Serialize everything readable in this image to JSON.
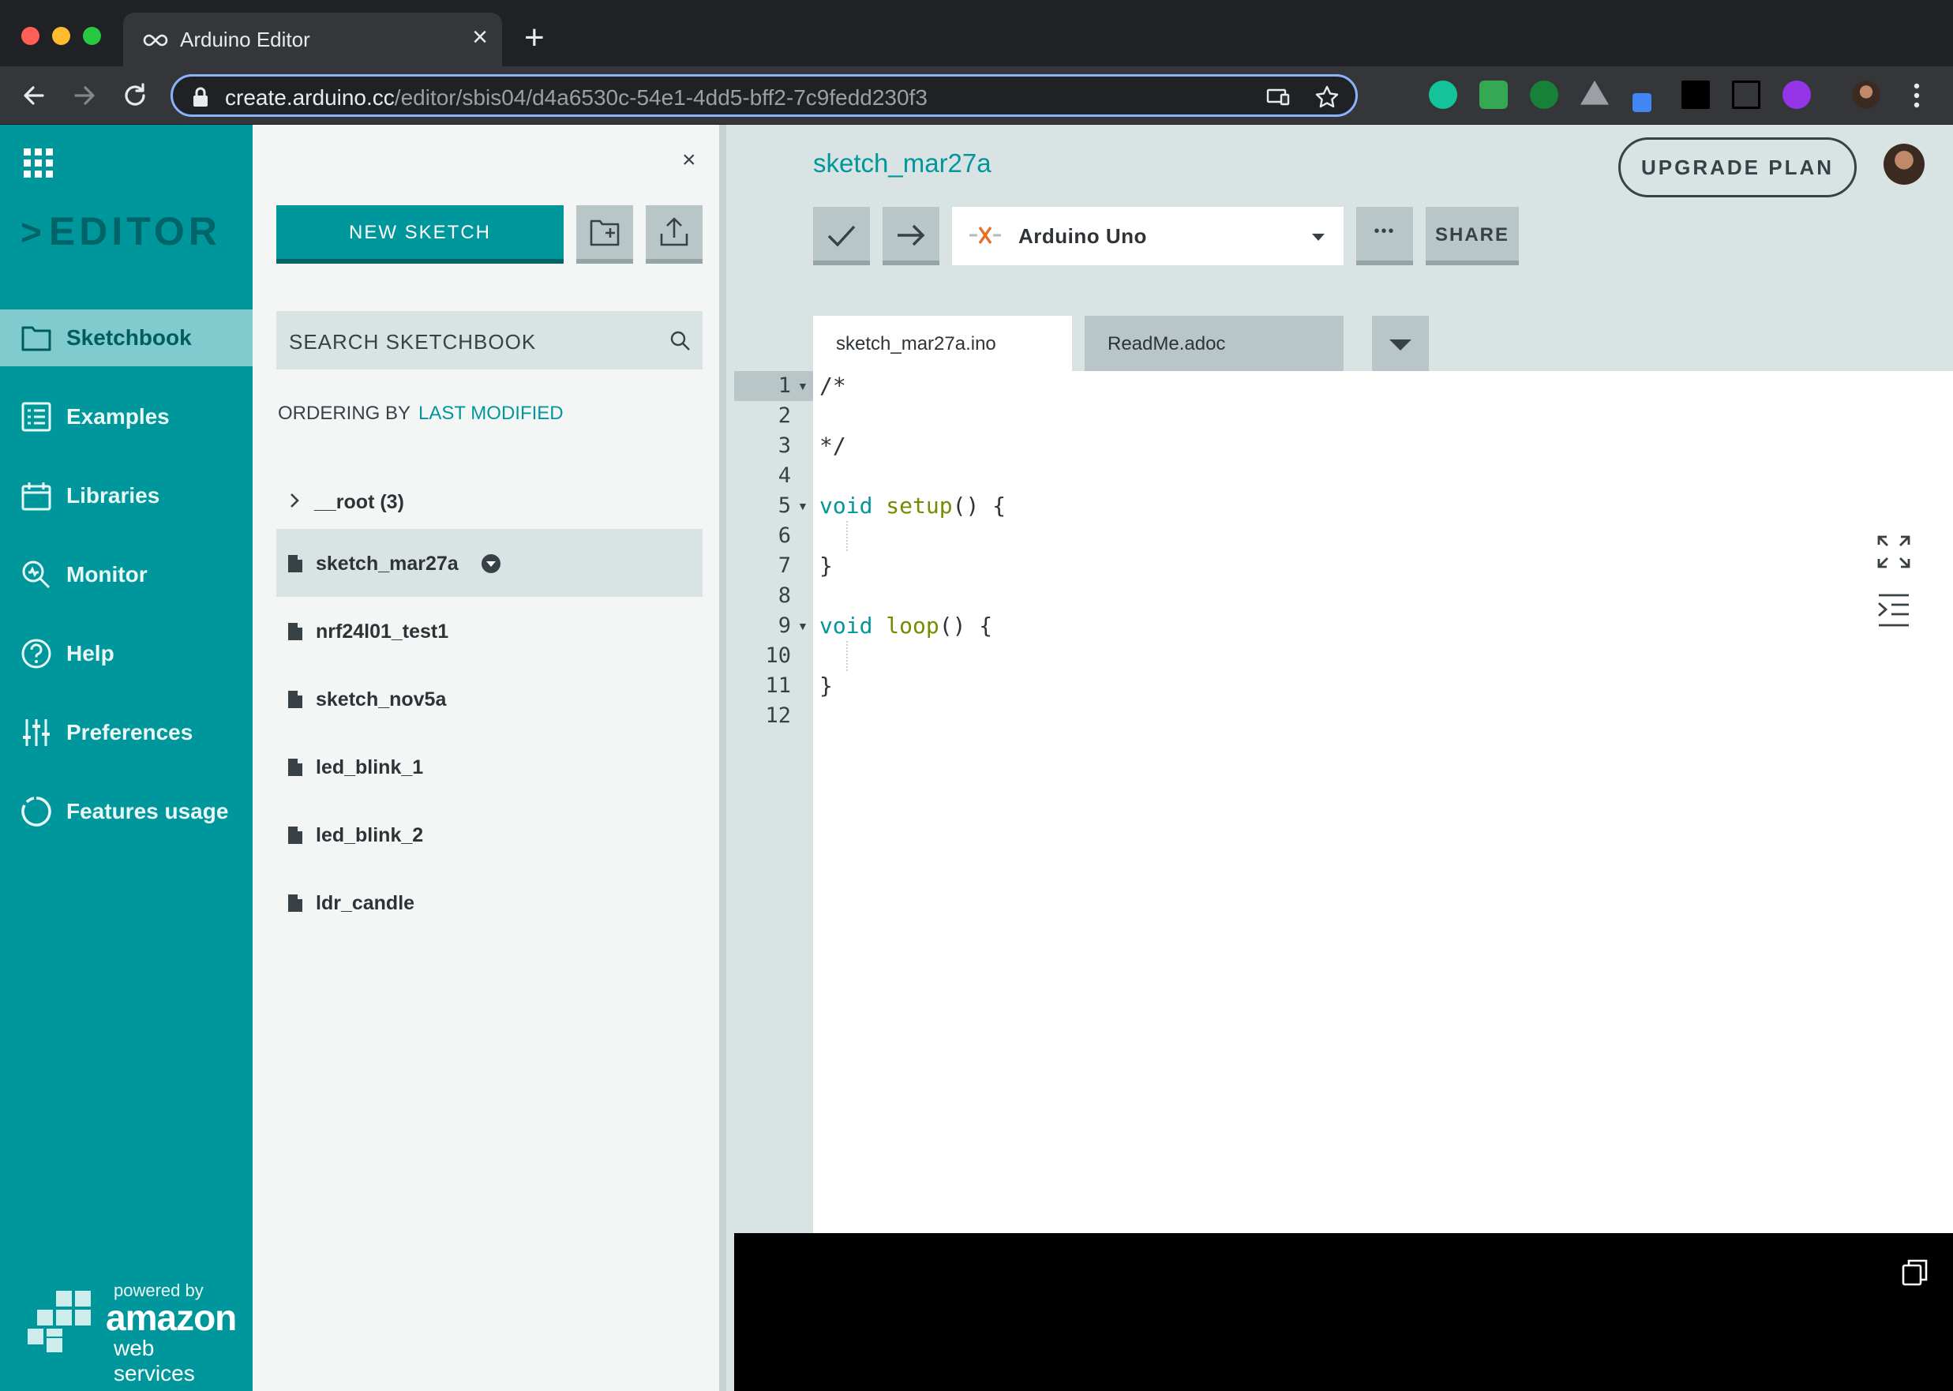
{
  "browser": {
    "tab_title": "Arduino Editor",
    "tab_close": "×",
    "new_tab": "+",
    "url_host": "create.arduino.cc",
    "url_path": "/editor/sbis04/d4a6530c-54e1-4dd5-bff2-7c9fedd230f3"
  },
  "sidebar": {
    "brand": "EDITOR",
    "items": [
      {
        "label": "Sketchbook",
        "icon": "folder-icon",
        "active": true
      },
      {
        "label": "Examples",
        "icon": "list-icon",
        "active": false
      },
      {
        "label": "Libraries",
        "icon": "library-icon",
        "active": false
      },
      {
        "label": "Monitor",
        "icon": "monitor-icon",
        "active": false
      },
      {
        "label": "Help",
        "icon": "help-icon",
        "active": false
      },
      {
        "label": "Preferences",
        "icon": "sliders-icon",
        "active": false
      },
      {
        "label": "Features usage",
        "icon": "pie-icon",
        "active": false
      }
    ],
    "powered_by": "powered by",
    "aws_amazon": "amazon",
    "aws_ws": "web services"
  },
  "panel": {
    "close": "×",
    "new_sketch": "NEW SKETCH",
    "search_placeholder": "SEARCH SKETCHBOOK",
    "ordering_label": "ORDERING BY",
    "ordering_value": "LAST MODIFIED",
    "root_folder": "__root (3)",
    "sketches": [
      "sketch_mar27a",
      "nrf24l01_test1",
      "sketch_nov5a",
      "led_blink_1",
      "led_blink_2",
      "ldr_candle"
    ],
    "selected_sketch": "sketch_mar27a"
  },
  "editor": {
    "sketch_title": "sketch_mar27a",
    "upgrade": "UPGRADE PLAN",
    "board": "Arduino Uno",
    "more": "•••",
    "share": "SHARE",
    "tabs": [
      "sketch_mar27a.ino",
      "ReadMe.adoc"
    ],
    "line_numbers": [
      "1",
      "2",
      "3",
      "4",
      "5",
      "6",
      "7",
      "8",
      "9",
      "10",
      "11",
      "12"
    ],
    "code": {
      "l1": "/*",
      "l3": "*/",
      "l5_kw": "void",
      "l5_fn": "setup",
      "l5_rest": "() {",
      "l7": "}",
      "l9_kw": "void",
      "l9_fn": "loop",
      "l9_rest": "() {",
      "l11": "}"
    }
  },
  "colors": {
    "brand_teal": "#00979c",
    "dark_teal": "#006468",
    "function_green": "#728e00"
  }
}
